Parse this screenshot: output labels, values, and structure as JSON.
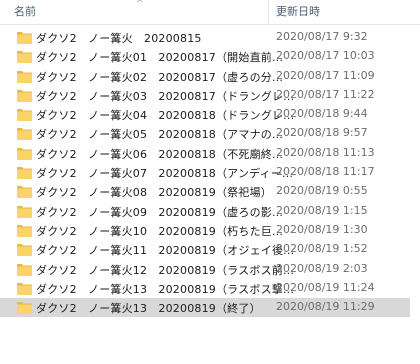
{
  "header": {
    "name_label": "名前",
    "date_label": "更新日時",
    "sort_glyph": "^"
  },
  "colors": {
    "folder": "#f8d46b",
    "folder_dark": "#e8b84a",
    "hover_row": "#d8d8d8"
  },
  "rows": [
    {
      "name": "ダクソ2　ノー篝火　20200815",
      "date": "2020/08/17 9:32"
    },
    {
      "name": "ダクソ2　ノー篝火01　20200817（開始直前...",
      "date": "2020/08/17 10:03"
    },
    {
      "name": "ダクソ2　ノー篝火02　20200817（虚ろの分...",
      "date": "2020/08/17 11:09"
    },
    {
      "name": "ダクソ2　ノー篝火03　20200817（ドラングレ...",
      "date": "2020/08/17 11:22"
    },
    {
      "name": "ダクソ2　ノー篝火04　20200818（ドラングレ...",
      "date": "2020/08/18 9:44"
    },
    {
      "name": "ダクソ2　ノー篝火05　20200818（アマナの...",
      "date": "2020/08/18 9:57"
    },
    {
      "name": "ダクソ2　ノー篝火06　20200818（不死廟終...",
      "date": "2020/08/18 11:13"
    },
    {
      "name": "ダクソ2　ノー篝火07　20200818（アンディー...",
      "date": "2020/08/18 11:17"
    },
    {
      "name": "ダクソ2　ノー篝火08　20200819（祭祀場）",
      "date": "2020/08/19 0:55"
    },
    {
      "name": "ダクソ2　ノー篝火09　20200819（虚ろの影...",
      "date": "2020/08/19 1:15"
    },
    {
      "name": "ダクソ2　ノー篝火10　20200819（朽ちた巨...",
      "date": "2020/08/19 1:30"
    },
    {
      "name": "ダクソ2　ノー篝火11　20200819（オジェイ後...",
      "date": "2020/08/19 1:52"
    },
    {
      "name": "ダクソ2　ノー篝火12　20200819（ラスボス前...",
      "date": "2020/08/19 2:03"
    },
    {
      "name": "ダクソ2　ノー篝火13　20200819（ラスボス撃...",
      "date": "2020/08/19 11:24"
    },
    {
      "name": "ダクソ2　ノー篝火13　20200819（終了）",
      "date": "2020/08/19 11:29"
    }
  ]
}
